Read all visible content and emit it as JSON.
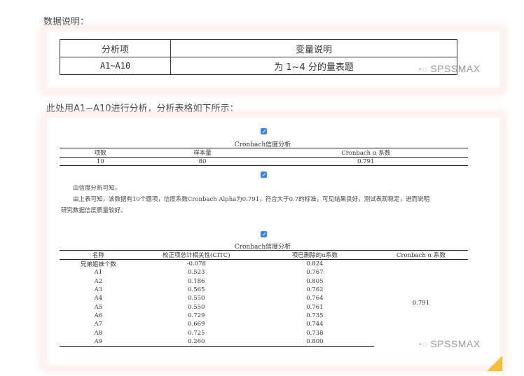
{
  "top_text": "",
  "data_desc_label": "数据说明：",
  "var_table": {
    "headers": [
      "分析项",
      "变量说明"
    ],
    "rows": [
      [
        "A1~A10",
        "为 1~4 分的量表题"
      ]
    ]
  },
  "watermark": "SPSSMAX",
  "intro_text": "此处用A1~A10进行分析，分析表格如下所示：",
  "reliability": {
    "caption": "Cronbach信度分析",
    "headers": [
      "项数",
      "样本量",
      "Cronbach α 系数"
    ],
    "row": [
      "10",
      "80",
      "0.791"
    ]
  },
  "analysis": {
    "line1": "由信度分析可知，",
    "line2": "由上表可知，该数据有10个题项，信度系数Cronbach Alpha为0.791，符合大于0.7的标准，可见结果良好，测试表现稳定，进而说明",
    "line3": "研究数据信度质量较好。"
  },
  "item_table": {
    "caption": "Cronbach信度分析",
    "headers": [
      "名称",
      "校正项总计相关性(CITC)",
      "项已删除的α系数",
      "Cronbach α 系数"
    ],
    "rows": [
      [
        "兄弟姐妹个数",
        "-0.078",
        "0.824"
      ],
      [
        "A1",
        "0.523",
        "0.767"
      ],
      [
        "A2",
        "0.186",
        "0.805"
      ],
      [
        "A3",
        "0.565",
        "0.762"
      ],
      [
        "A4",
        "0.550",
        "0.764"
      ],
      [
        "A5",
        "0.550",
        "0.761"
      ],
      [
        "A6",
        "0.729",
        "0.735"
      ],
      [
        "A7",
        "0.669",
        "0.744"
      ],
      [
        "A8",
        "0.725",
        "0.738"
      ],
      [
        "A9",
        "0.260",
        "0.800"
      ]
    ],
    "alpha": "0.791"
  }
}
